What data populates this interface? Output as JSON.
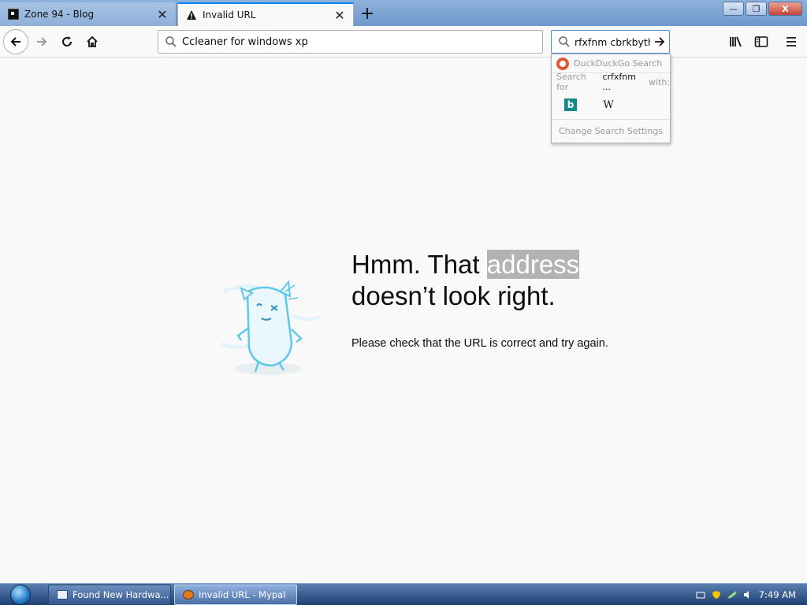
{
  "browser": {
    "tabs": [
      {
        "title": "Zone 94 - Blog",
        "active": false,
        "close_label": "✕"
      },
      {
        "title": "Invalid URL",
        "active": true,
        "close_label": "✕"
      }
    ],
    "new_tab_label": "+",
    "window_controls": {
      "minimize": "—",
      "restore": "❐",
      "close": "X"
    },
    "url_bar": {
      "value": "Ccleaner for windows xp"
    },
    "search_bar": {
      "value": "rfxfnm cbrkbyth"
    },
    "search_dropdown": {
      "engine_header": "DuckDuckGo Search",
      "search_for_prefix": "Search for",
      "query_short": "crfxfnm ...",
      "with_label": "with:",
      "engines": [
        "Bing",
        "Wikipedia"
      ],
      "wiki_glyph": "W",
      "bing_glyph": "b",
      "settings_label": "Change Search Settings"
    }
  },
  "error_page": {
    "title_part1": "Hmm. That",
    "title_highlight": "address",
    "title_part2": "doesn’t look right.",
    "description": "Please check that the URL is correct and try again."
  },
  "taskbar": {
    "items": [
      {
        "label": "Found New Hardwa..."
      },
      {
        "label": "Invalid URL - Mypal"
      }
    ],
    "clock": "7:49 AM"
  },
  "colors": {
    "accent": "#0a84ff",
    "page_bg": "#f9f9fa",
    "highlight_bg": "#b3b3b3",
    "illustration": "#5ec8ea"
  }
}
